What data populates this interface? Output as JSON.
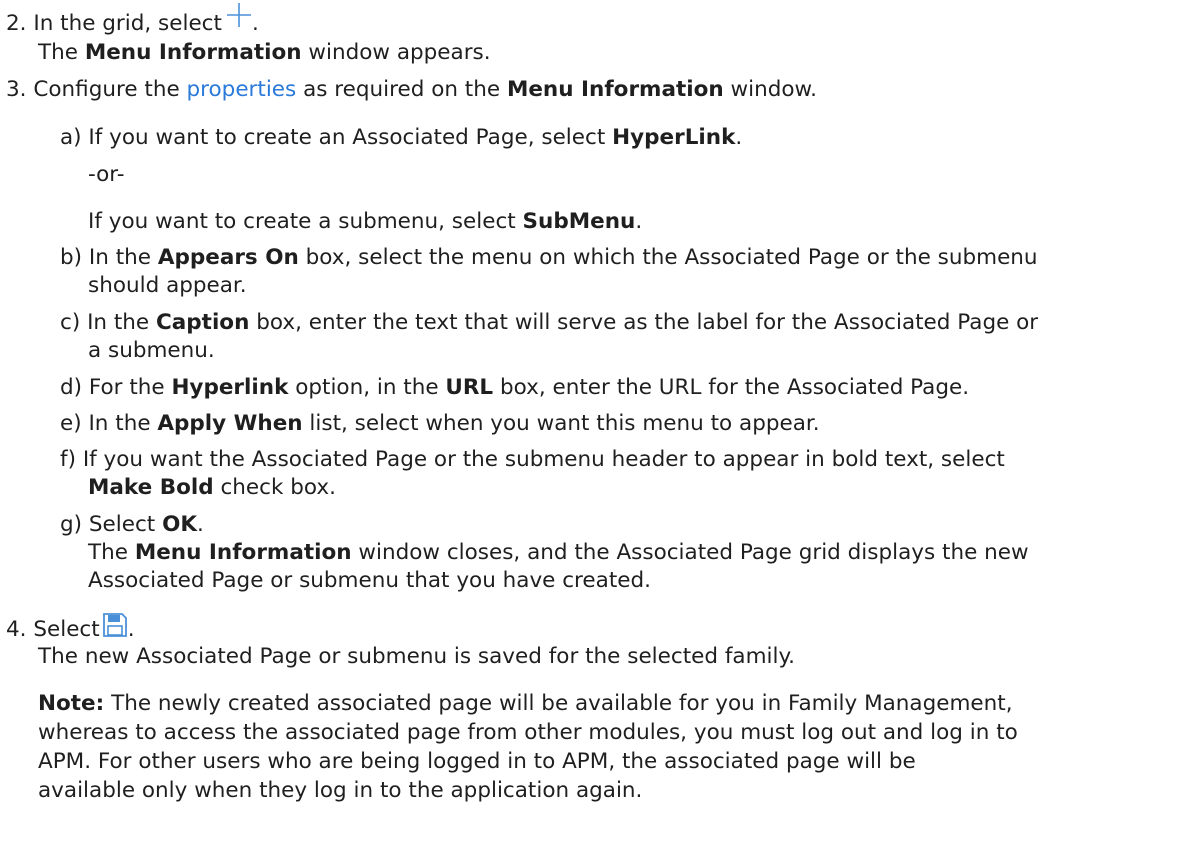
{
  "step2": {
    "num": "2.",
    "text": "In the grid, select",
    "icon": "plus-icon",
    "end": ".",
    "result_pre": "The ",
    "result_bold": "Menu Information",
    "result_post": " window appears."
  },
  "step3": {
    "num": "3.",
    "pre": "Configure the ",
    "link": "properties",
    "mid": " as required on the ",
    "bold": "Menu Information",
    "post": " window.",
    "sub": {
      "a": {
        "label": "a)",
        "pre": "If you want to create an Associated Page, select ",
        "bold": "HyperLink",
        "post": ".",
        "or": "-or-",
        "alt_pre": "If you want to create a submenu, select ",
        "alt_bold": "SubMenu",
        "alt_post": "."
      },
      "b": {
        "label": "b)",
        "pre": "In the ",
        "bold": "Appears On",
        "post1": " box, select the menu on which the Associated Page or the submenu",
        "post2": "should appear."
      },
      "c": {
        "label": "c)",
        "pre": "In the ",
        "bold": "Caption",
        "post1": " box, enter the text that will serve as the label for the Associated Page or",
        "post2": "a submenu."
      },
      "d": {
        "label": "d)",
        "pre": "For the ",
        "bold1": "Hyperlink",
        "mid": " option, in the ",
        "bold2": "URL",
        "post": " box, enter the URL for the Associated Page."
      },
      "e": {
        "label": "e)",
        "pre": "In the ",
        "bold": "Apply When",
        "post": " list, select when you want this menu to appear."
      },
      "f": {
        "label": "f)",
        "line1": "If you want the Associated Page or the submenu header to appear in bold text, select",
        "bold": "Make Bold",
        "post": " check box."
      },
      "g": {
        "label": "g)",
        "pre": "Select ",
        "bold": "OK",
        "post": ".",
        "result_pre": "The ",
        "result_bold": "Menu Information",
        "result_post": " window closes, and the Associated Page grid displays the new",
        "result_line2": "Associated Page or submenu that you have created."
      }
    }
  },
  "step4": {
    "num": "4.",
    "text": "Select",
    "icon": "save-icon",
    "end": ".",
    "result": "The new Associated Page or submenu is saved for the selected family."
  },
  "note": {
    "label": "Note:",
    "line1": " The newly created associated page will be available for you in Family Management,",
    "line2": "whereas to access the associated page from other modules, you must log out and log in to",
    "line3": "APM. For other users who are being logged in to APM, the associated page will be",
    "line4": "available only when they log in to the application again."
  },
  "colors": {
    "text": "#1f1f1f",
    "link": "#2b7ad9",
    "icon": "#4a90d9"
  }
}
